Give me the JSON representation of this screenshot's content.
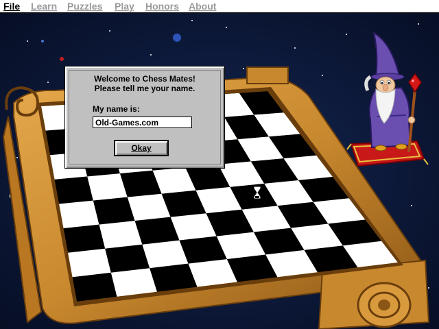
{
  "menubar": {
    "items": [
      {
        "label": "File",
        "enabled": true
      },
      {
        "label": "Learn",
        "enabled": false
      },
      {
        "label": "Puzzles",
        "enabled": false
      },
      {
        "label": "Play",
        "enabled": false
      },
      {
        "label": "Honors",
        "enabled": false
      },
      {
        "label": "About",
        "enabled": false
      }
    ]
  },
  "dialog": {
    "line1": "Welcome to Chess Mates!",
    "line2": "Please tell me your name.",
    "name_label": "My name is:",
    "name_value": "Old-Games.com",
    "okay_label": "Okay"
  },
  "scene": {
    "icons": [
      "wizard-icon",
      "chessboard-icon",
      "hourglass-cursor-icon",
      "magic-carpet-icon",
      "planet-icon"
    ]
  },
  "colors": {
    "space": "#0a1530",
    "board_wood": "#c8882e",
    "dialog_face": "#c0c0c0",
    "disabled_menu": "#9a9a9a",
    "wizard_robe": "#6a4fb0"
  }
}
